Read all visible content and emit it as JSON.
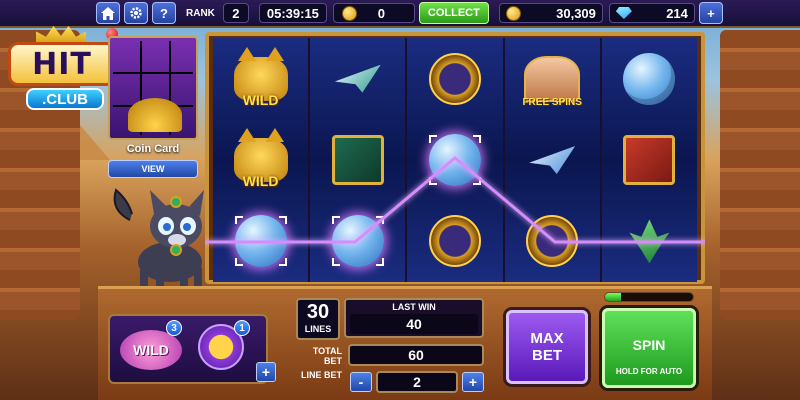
{
  "topbar": {
    "rank_label": "RANK",
    "rank_value": "2",
    "timer": "05:39:15",
    "tokens": "0",
    "collect_label": "COLLECT",
    "coins": "30,309",
    "gems": "214",
    "home_icon": "home-icon",
    "settings_icon": "gear-icon",
    "help_label": "?",
    "plus_label": "+"
  },
  "logo": {
    "hit": "HIT",
    "club": ".CLUB"
  },
  "coin_card": {
    "label": "Coin Card",
    "view_label": "VIEW"
  },
  "reels": [
    [
      {
        "symbol": "wild-cat",
        "text": "WILD"
      },
      {
        "symbol": "wild-cat",
        "text": "WILD"
      },
      {
        "symbol": "yarn-ball",
        "text": ""
      }
    ],
    [
      {
        "symbol": "paper-plane",
        "text": ""
      },
      {
        "symbol": "green-tablet",
        "text": ""
      },
      {
        "symbol": "yarn-ball",
        "text": ""
      }
    ],
    [
      {
        "symbol": "scarab-amulet",
        "text": ""
      },
      {
        "symbol": "yarn-ball",
        "text": ""
      },
      {
        "symbol": "scarab-amulet",
        "text": ""
      }
    ],
    [
      {
        "symbol": "explorer-girl",
        "text": "FREE SPINS"
      },
      {
        "symbol": "paper-plane",
        "text": ""
      },
      {
        "symbol": "scarab-amulet",
        "text": ""
      }
    ],
    [
      {
        "symbol": "yarn-ball",
        "text": ""
      },
      {
        "symbol": "red-tablet",
        "text": ""
      },
      {
        "symbol": "lotus-leaf",
        "text": ""
      }
    ]
  ],
  "winning_line": {
    "rows": [
      2,
      2,
      1,
      2,
      2
    ],
    "color": "#d48cff"
  },
  "bonus": {
    "wild_label": "WILD",
    "wild_count": "3",
    "coin_count": "1",
    "plus_label": "+"
  },
  "bet_panel": {
    "lines_value": "30",
    "lines_label": "LINES",
    "last_win_label": "LAST WIN",
    "last_win_value": "40",
    "total_bet_label": "TOTAL BET",
    "total_bet_value": "60",
    "line_bet_label": "LINE BET",
    "line_bet_value": "2",
    "minus_label": "-",
    "plus_label": "+"
  },
  "max_bet_label": "MAX BET",
  "spin": {
    "label": "SPIN",
    "hint": "HOLD FOR AUTO",
    "progress": 0.18
  },
  "colors": {
    "collect": "#3fb82a",
    "spin": "#2faa2a",
    "max_bet": "#7a3ad8",
    "accent_gold": "#c8953a"
  }
}
